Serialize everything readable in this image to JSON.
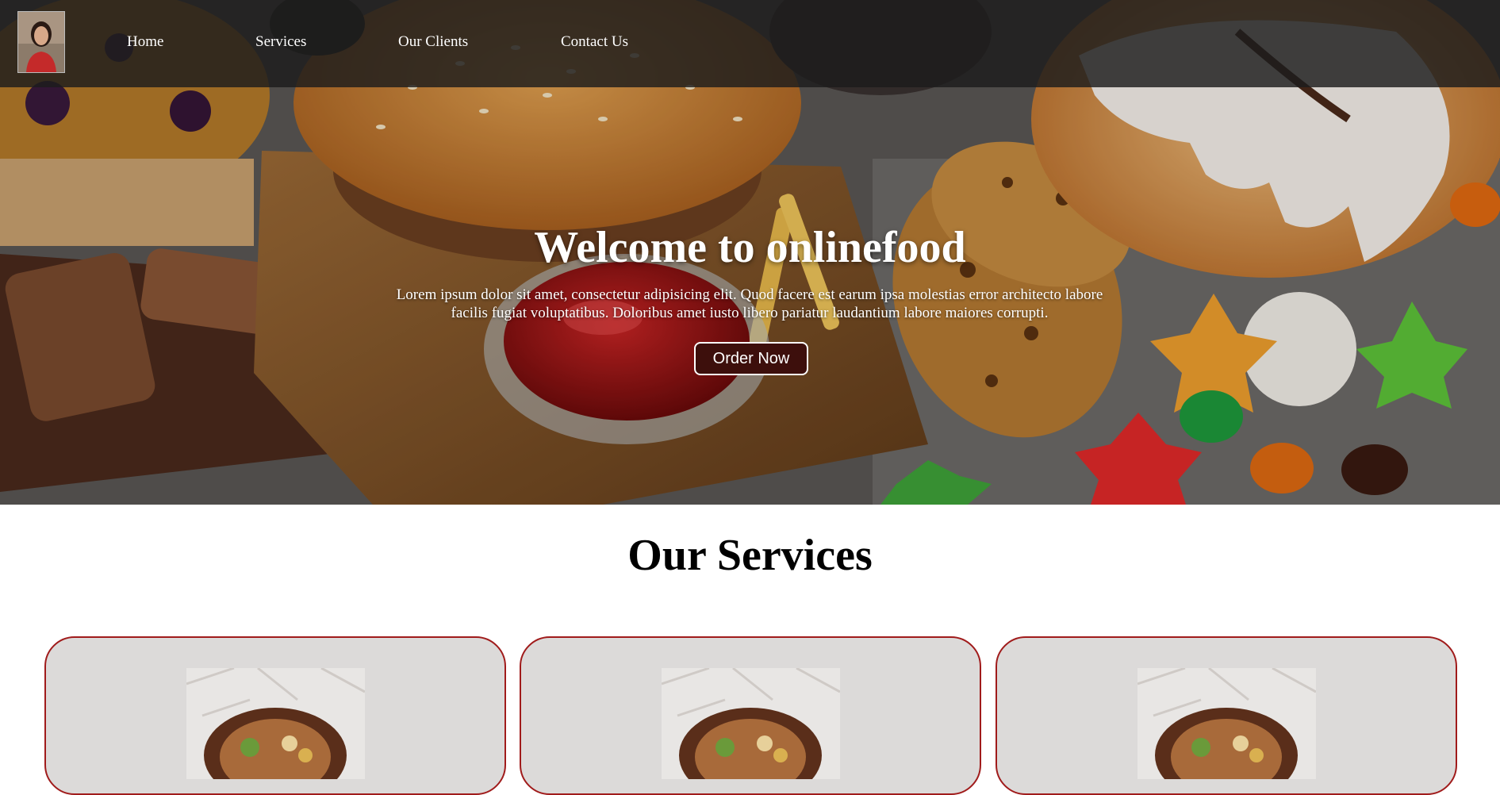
{
  "nav": {
    "links": [
      "Home",
      "Services",
      "Our Clients",
      "Contact Us"
    ]
  },
  "hero": {
    "title": "Welcome to onlinefood",
    "text": "Lorem ipsum dolor sit amet, consectetur adipisicing elit. Quod facere est earum ipsa molestias error architecto labore facilis fugiat voluptatibus. Doloribus amet iusto libero pariatur laudantium labore maiores corrupti.",
    "button_label": "Order Now"
  },
  "services": {
    "heading": "Our Services"
  },
  "colors": {
    "button_bg": "#3d0f0c",
    "card_border": "#a01b1b",
    "card_bg": "#dcdad9"
  },
  "icons": [
    "profile-photo",
    "food-plate-photo"
  ]
}
